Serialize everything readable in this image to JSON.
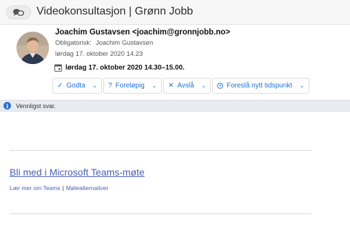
{
  "subject": "Videokonsultasjon | Grønn Jobb",
  "icons": {
    "chat": "chat-bubbles-icon",
    "calendar": "calendar-icon",
    "check": "check-icon",
    "question": "question-icon",
    "cross": "x-icon",
    "clock": "clock-icon",
    "chevron": "chevron-down-icon",
    "info": "info-icon"
  },
  "header": {
    "from": "Joachim Gustavsen <joachim@gronnjobb.no>",
    "required_label": "Obligatorisk:",
    "required_value": "Joachim Gustavsen",
    "sent": "lørdag 17. oktober 2020 14.23",
    "meeting_time": "lørdag 17. oktober 2020 14.30–15.00."
  },
  "responses": {
    "accept": "Godta",
    "tentative": "Foreløpig",
    "decline": "Avslå",
    "propose": "Foreslå nytt tidspunkt"
  },
  "info_bar": {
    "text": "Vennligst svar.",
    "color": "#e8ecf1"
  },
  "body": {
    "teams_link": "Bli med i Microsoft Teams-møte",
    "learn_more": "Lær mer om Teams",
    "separator": "|",
    "meeting_options": "Møtealternativer"
  },
  "colors": {
    "accent": "#1f6fd6",
    "link": "#4a5fb0"
  }
}
